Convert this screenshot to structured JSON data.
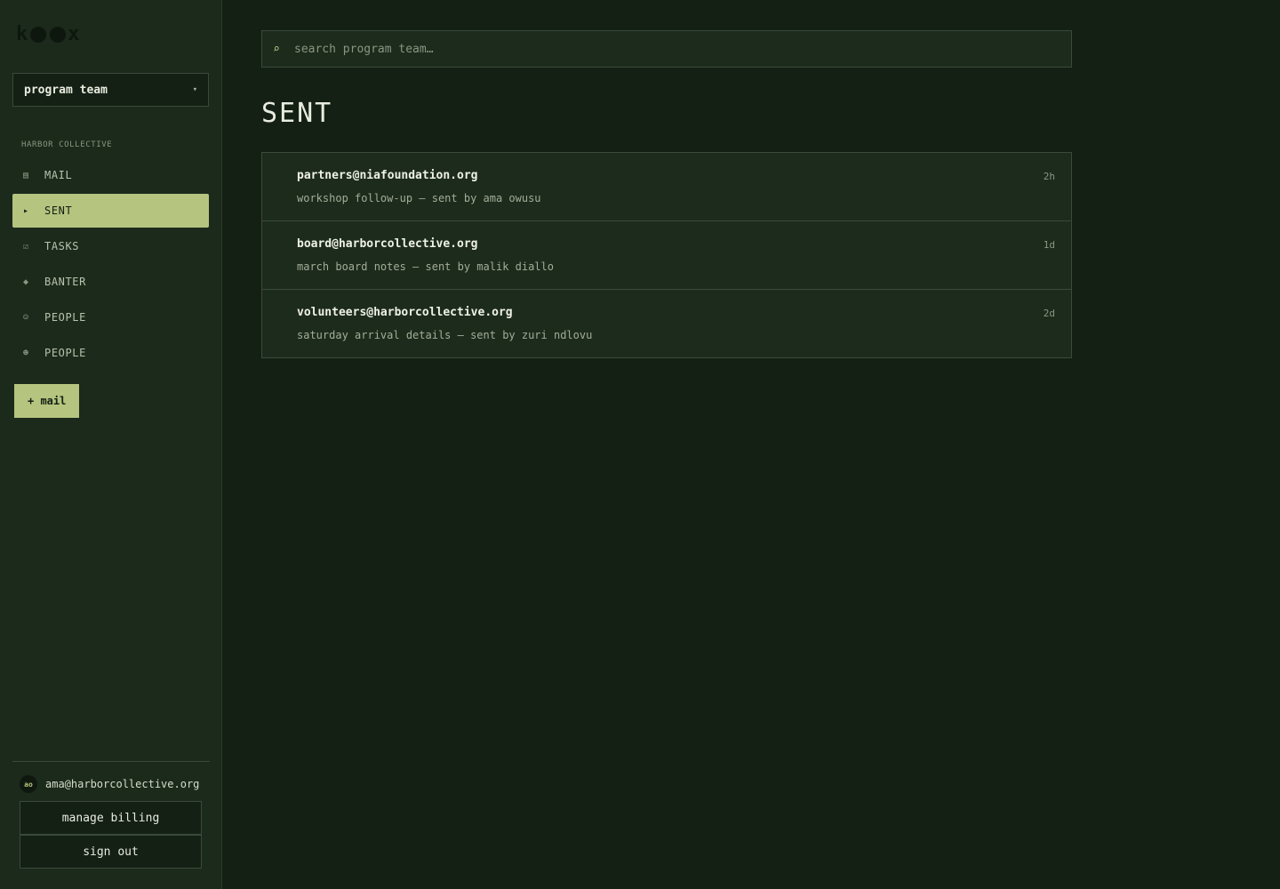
{
  "brand": {
    "logo_left": "k",
    "logo_right": "x"
  },
  "team_select": {
    "value": "program team",
    "caret": "▾"
  },
  "sidebar": {
    "org_label": "HARBOR COLLECTIVE",
    "items": [
      {
        "label": "MAIL",
        "icon": "inbox-icon",
        "glyph": "▤"
      },
      {
        "label": "SENT",
        "icon": "send-icon",
        "glyph": "▸"
      },
      {
        "label": "TASKS",
        "icon": "checkbox-icon",
        "glyph": "☑"
      },
      {
        "label": "BANTER",
        "icon": "chat-icon",
        "glyph": "◆"
      },
      {
        "label": "PEOPLE",
        "icon": "person-icon",
        "glyph": "☺"
      },
      {
        "label": "PEOPLE",
        "icon": "people-icon",
        "glyph": "☻"
      }
    ],
    "active_index": 1,
    "new_mail_label": "+ mail"
  },
  "account": {
    "initials": "ao",
    "email": "ama@harborcollective.org",
    "billing_label": "manage billing",
    "signout_label": "sign out"
  },
  "search": {
    "placeholder": "search program team…",
    "icon": "search-icon",
    "glyph": "⌕"
  },
  "page": {
    "title": "SENT"
  },
  "mails": [
    {
      "to": "partners@niafoundation.org",
      "subject": "workshop follow-up — sent by ama owusu",
      "time": "2h"
    },
    {
      "to": "board@harborcollective.org",
      "subject": "march board notes — sent by malik diallo",
      "time": "1d"
    },
    {
      "to": "volunteers@harborcollective.org",
      "subject": "saturday arrival details — sent by zuri ndlovu",
      "time": "2d"
    }
  ],
  "colors": {
    "background": "#142014",
    "sidebar": "#1b2a1b",
    "accent": "#b5c47f",
    "border": "#3a4a3a"
  }
}
